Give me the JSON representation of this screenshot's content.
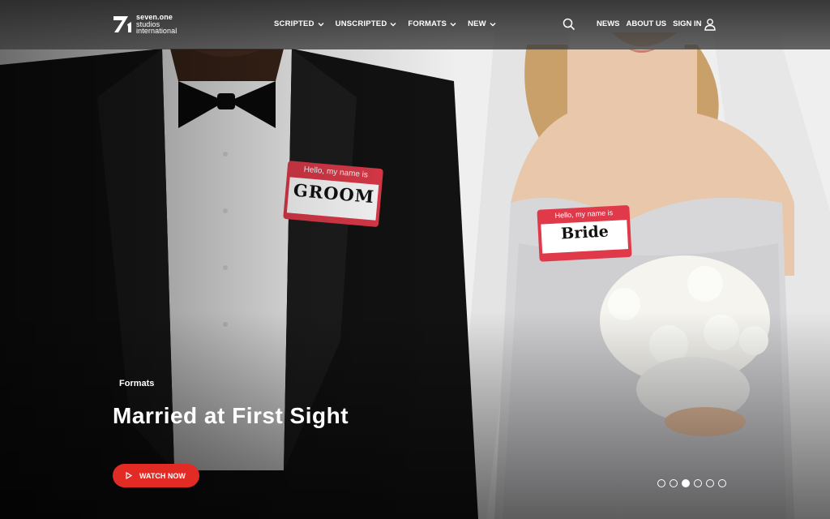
{
  "logo": {
    "line1": "seven.one",
    "line2": "studios",
    "line3": "international"
  },
  "nav": {
    "items": [
      {
        "label": "SCRIPTED"
      },
      {
        "label": "UNSCRIPTED"
      },
      {
        "label": "FORMATS"
      },
      {
        "label": "NEW"
      }
    ],
    "right": {
      "news": "NEWS",
      "about": "ABOUT US",
      "signin": "SIGN IN"
    }
  },
  "hero": {
    "category": "Formats",
    "title": "Married at First Sight",
    "cta": "WATCH NOW",
    "badges": {
      "groom_header": "Hello, my name is",
      "groom_name": "GROOM",
      "bride_header": "Hello, my name is",
      "bride_name": "Bride"
    }
  },
  "carousel": {
    "count": 6,
    "active_index": 2
  },
  "colors": {
    "accent": "#e32b25",
    "header_bg": "#333333",
    "text": "#ffffff"
  }
}
